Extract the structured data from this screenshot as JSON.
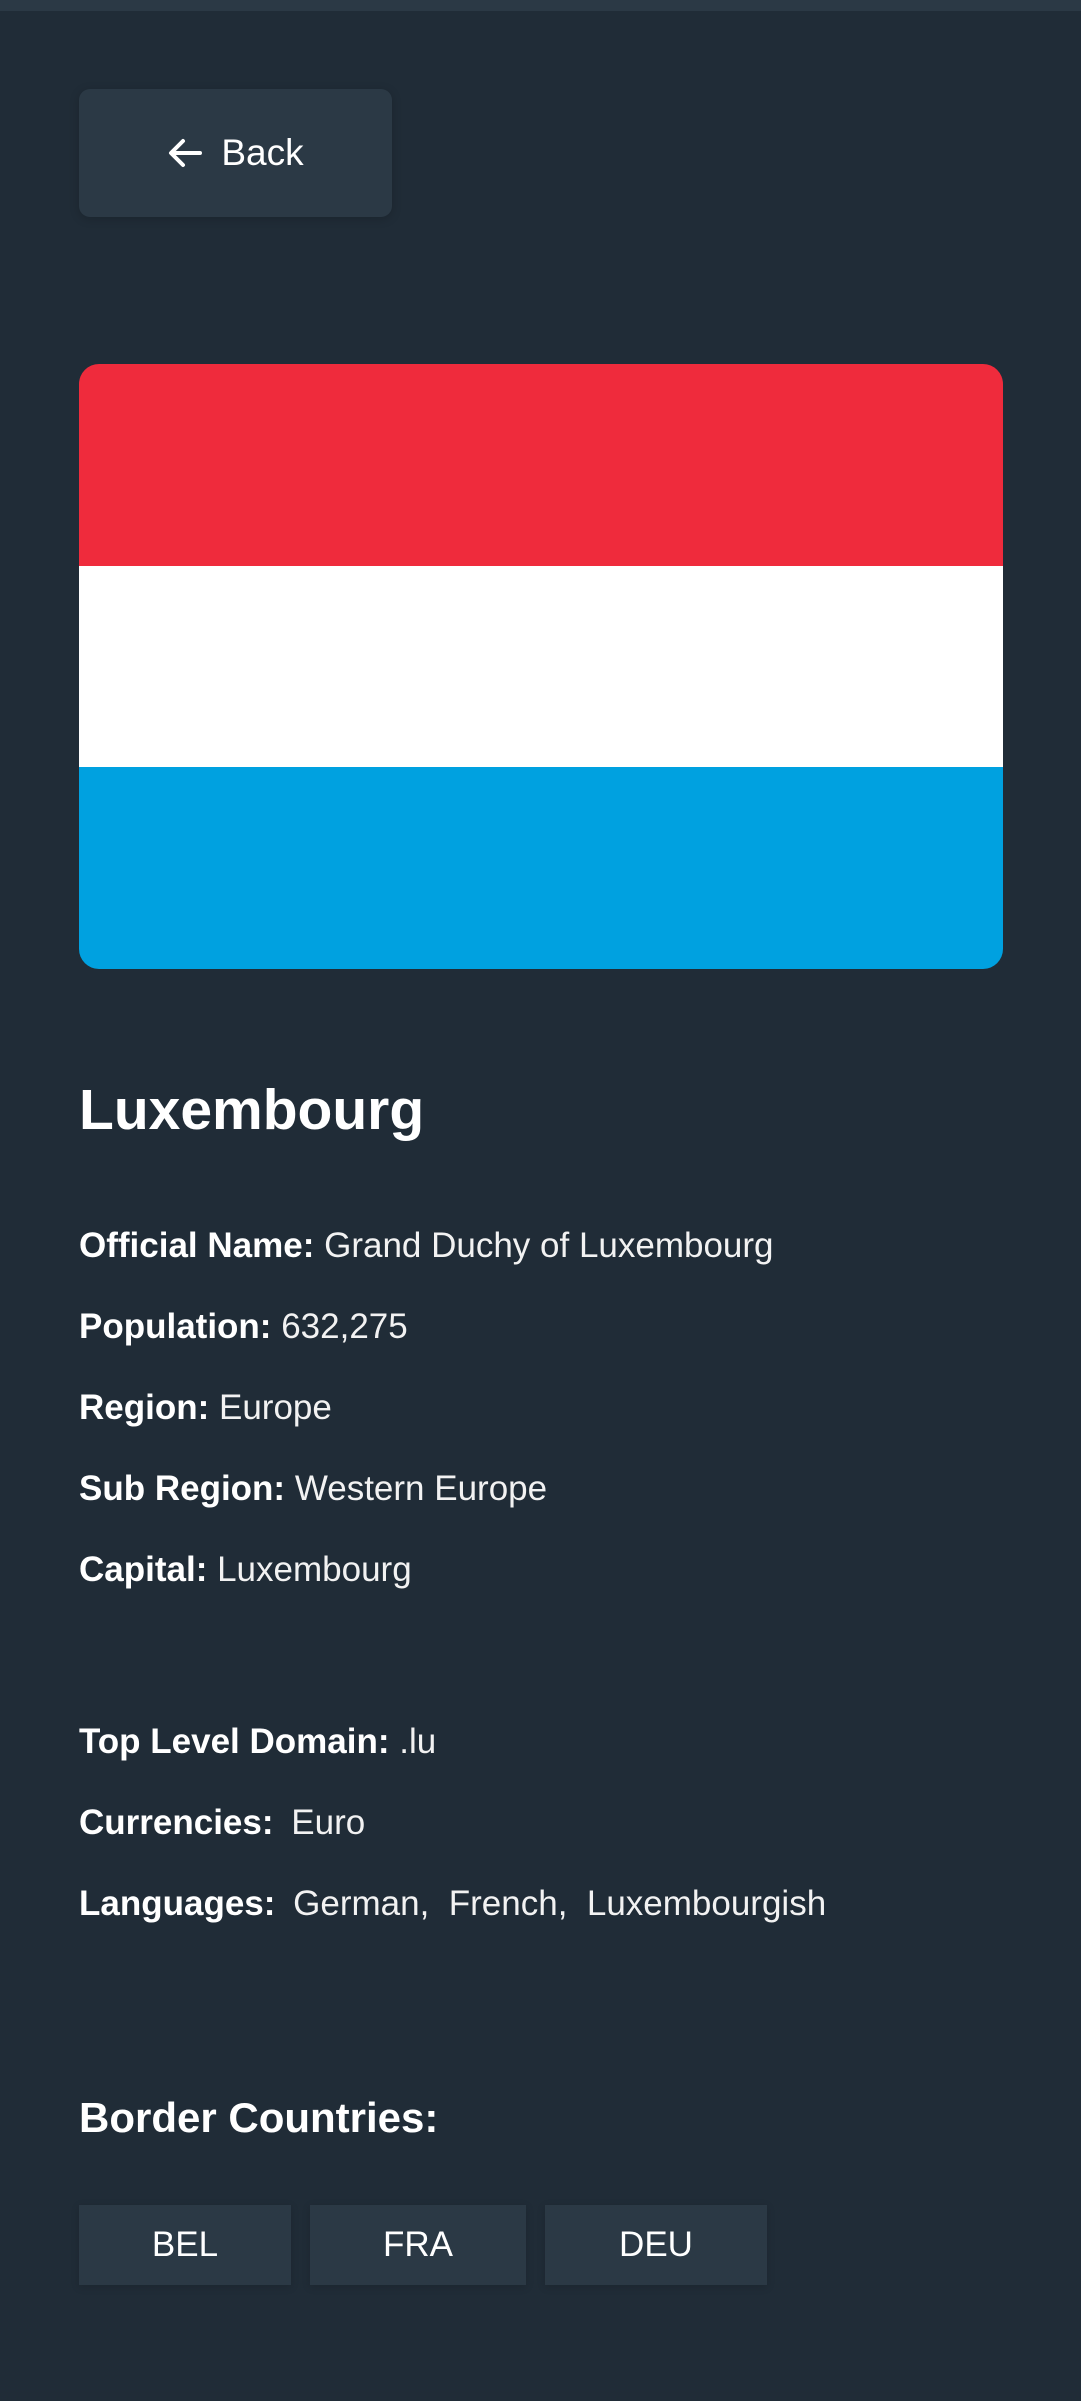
{
  "back_button": {
    "label": "Back",
    "icon": "arrow-left-icon"
  },
  "flag": {
    "alt": "Flag of Luxembourg",
    "stripes": [
      "#ef2b3c",
      "#ffffff",
      "#00a1e0"
    ]
  },
  "country": {
    "name": "Luxembourg",
    "details": [
      {
        "label": "Official Name:",
        "value": "Grand Duchy of Luxembourg"
      },
      {
        "label": "Population:",
        "value": "632,275"
      },
      {
        "label": "Region:",
        "value": "Europe"
      },
      {
        "label": "Sub Region:",
        "value": "Western Europe"
      },
      {
        "label": "Capital:",
        "value": "Luxembourg"
      }
    ],
    "extra_details": [
      {
        "label": "Top Level Domain:",
        "value": ".lu"
      },
      {
        "label": "Currencies:",
        "value": "Euro"
      },
      {
        "label": "Languages:",
        "value": "German,  French,  Luxembourgish"
      }
    ]
  },
  "borders": {
    "title": "Border Countries:",
    "countries": [
      "BEL",
      "FRA",
      "DEU"
    ]
  },
  "colors": {
    "background": "#202c37",
    "element": "#2b3945",
    "text": "#ffffff"
  }
}
